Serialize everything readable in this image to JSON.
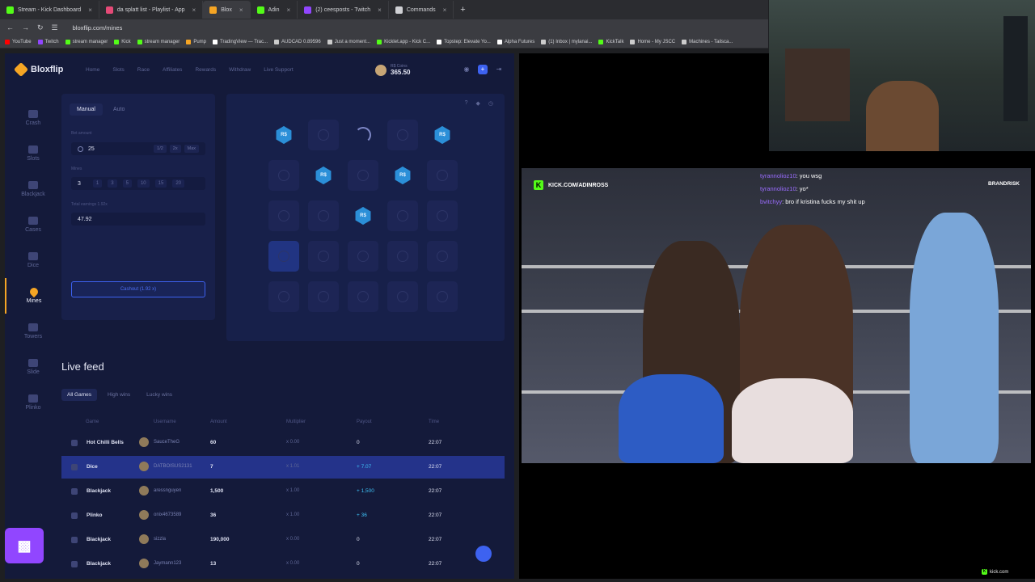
{
  "browser": {
    "tabs": [
      {
        "label": "Stream - Kick Dashboard",
        "color": "#53fc18"
      },
      {
        "label": "da splatt list - Playlist - App",
        "color": "#e54a77"
      },
      {
        "label": "Blox",
        "color": "#f5a524"
      },
      {
        "label": "Adin",
        "color": "#53fc18"
      },
      {
        "label": "(2) ceesposts - Twitch",
        "color": "#9146ff"
      },
      {
        "label": "Commands",
        "color": "#cfd0d4"
      }
    ],
    "url": "bloxflip.com/mines",
    "bookmarks": [
      "YouTube",
      "Twitch",
      "stream manager",
      "Kick",
      "stream manager",
      "Pump",
      "TradingView — Trac...",
      "AUDCAD 0.89596",
      "Just a moment...",
      "Kicklet.app - Kick C...",
      "Topstep: Elevate Yo...",
      "Alpha Futures",
      "(1) Inbox | mylanai...",
      "KickTalk",
      "Home - My JSCC",
      "Machines - Tailsca..."
    ]
  },
  "site": {
    "logo": "Bloxflip",
    "nav": [
      "Home",
      "Slots",
      "Race",
      "Affiliates",
      "Rewards",
      "Withdraw",
      "Live Support"
    ],
    "balance_label": "R$ Coins",
    "balance": "365.50",
    "sidebar": [
      {
        "label": "Crash",
        "active": false
      },
      {
        "label": "Slots",
        "active": false
      },
      {
        "label": "Blackjack",
        "active": false
      },
      {
        "label": "Cases",
        "active": false
      },
      {
        "label": "Dice",
        "active": false
      },
      {
        "label": "Mines",
        "active": true
      },
      {
        "label": "Towers",
        "active": false
      },
      {
        "label": "Slide",
        "active": false
      },
      {
        "label": "Plinko",
        "active": false
      }
    ],
    "controls": {
      "mode_manual": "Manual",
      "mode_auto": "Auto",
      "bet_label": "Bet amount",
      "bet_value": "25",
      "bet_chips": [
        "1/2",
        "2x",
        "Max"
      ],
      "mines_label": "Mines",
      "mines_value": "3",
      "mines_options": [
        "1",
        "3",
        "5",
        "10",
        "15",
        "20"
      ],
      "earnings_label": "Total earnings 1.92x",
      "earnings_value": "47.92",
      "cashout": "Cashout (1.92 x)"
    },
    "board": {
      "gem_text": "R$",
      "tiles": [
        "gem",
        "ghost",
        "spin",
        "ghost",
        "gem",
        "ghost",
        "gem",
        "ghost",
        "gem",
        "ghost",
        "ghost",
        "ghost",
        "gem",
        "ghost",
        "ghost",
        "picked",
        "ghost",
        "ghost",
        "ghost",
        "ghost",
        "ghost",
        "ghost",
        "ghost",
        "ghost",
        "ghost"
      ],
      "icons": [
        "?",
        "shield-icon",
        "clock-icon"
      ]
    },
    "live_feed": {
      "title": "Live feed",
      "tabs": [
        "All Games",
        "High wins",
        "Lucky wins"
      ],
      "headers": [
        "Game",
        "Username",
        "Amount",
        "Multiplier",
        "Payout",
        "Time"
      ],
      "rows": [
        {
          "game": "Hot Chilli Bells",
          "user": "SauceTheG",
          "amount": "60",
          "mult": "x 0.00",
          "payout": "0",
          "time": "22:07",
          "win": false,
          "hl": false
        },
        {
          "game": "Dice",
          "user": "DATBOISUS2131",
          "amount": "7",
          "mult": "x 1.01",
          "payout": "+ 7.07",
          "time": "22:07",
          "win": true,
          "hl": true
        },
        {
          "game": "Blackjack",
          "user": "aressnguyen",
          "amount": "1,500",
          "mult": "x 1.00",
          "payout": "+ 1,500",
          "time": "22:07",
          "win": true,
          "hl": false
        },
        {
          "game": "Plinko",
          "user": "onix4673589",
          "amount": "36",
          "mult": "x 1.00",
          "payout": "+ 36",
          "time": "22:07",
          "win": true,
          "hl": false
        },
        {
          "game": "Blackjack",
          "user": "sizzla",
          "amount": "190,000",
          "mult": "x 0.00",
          "payout": "0",
          "time": "22:07",
          "win": false,
          "hl": false
        },
        {
          "game": "Blackjack",
          "user": "Jaymann123",
          "amount": "13",
          "mult": "x 0.00",
          "payout": "0",
          "time": "22:07",
          "win": false,
          "hl": false
        }
      ]
    }
  },
  "stream": {
    "kick_url": "KICK.COM/ADINROSS",
    "brand": "BRANDRISK",
    "chat": [
      {
        "user": "tyrannolioz10",
        "msg": ": you wsg"
      },
      {
        "user": "tyrannolioz10",
        "msg": ": yo*"
      },
      {
        "user": "bvitchyy",
        "msg": ": bro if kristina fucks my shit up"
      }
    ],
    "kick_corner": "kick.com",
    "twitch_logo": "twitch"
  }
}
